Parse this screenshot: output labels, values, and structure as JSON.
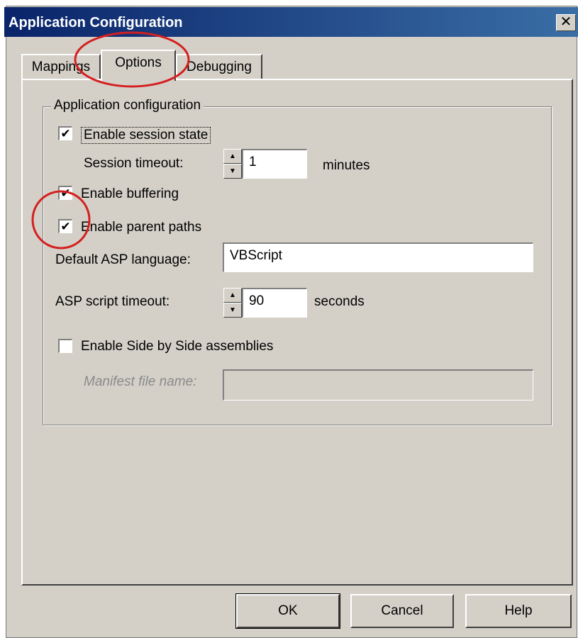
{
  "window": {
    "title": "Application Configuration",
    "close_icon": "close-icon"
  },
  "tabs": [
    {
      "label": "Mappings",
      "active": false
    },
    {
      "label": "Options",
      "active": true
    },
    {
      "label": "Debugging",
      "active": false
    }
  ],
  "group": {
    "label": "Application configuration",
    "enable_session_state": {
      "label": "Enable session state",
      "checked": true
    },
    "session_timeout": {
      "label": "Session timeout:",
      "value": "1",
      "unit": "minutes"
    },
    "enable_buffering": {
      "label": "Enable buffering",
      "checked": true
    },
    "enable_parent_paths": {
      "label": "Enable parent paths",
      "checked": true
    },
    "default_asp_language": {
      "label": "Default ASP language:",
      "value": "VBScript"
    },
    "asp_script_timeout": {
      "label": "ASP script timeout:",
      "value": "90",
      "unit": "seconds"
    },
    "enable_side_by_side": {
      "label": "Enable Side by Side assemblies",
      "checked": false
    },
    "manifest_file_name": {
      "label": "Manifest file name:",
      "value": ""
    }
  },
  "buttons": {
    "ok": "OK",
    "cancel": "Cancel",
    "help": "Help"
  },
  "check_mark": "✔",
  "annotation_color": "#d42020"
}
